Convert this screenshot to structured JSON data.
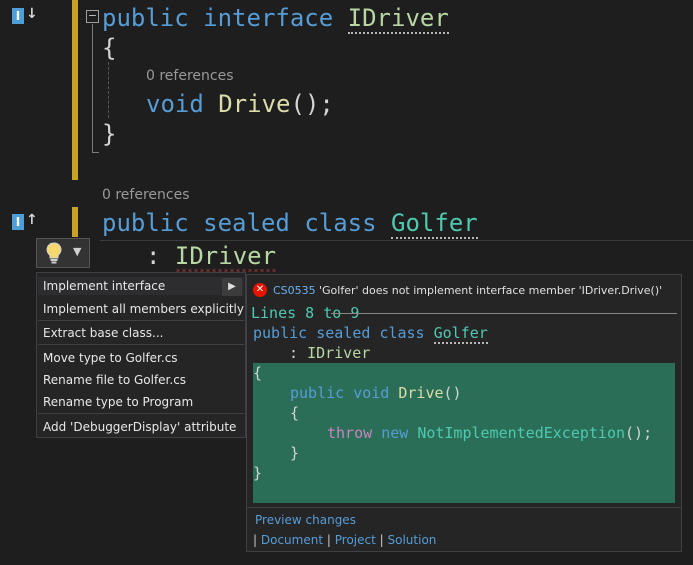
{
  "editor": {
    "line1": {
      "kw1": "public",
      "kw2": "interface",
      "name": "IDriver"
    },
    "open_brace": "{",
    "lens1": "0 references",
    "method": {
      "kw": "void",
      "name": "Drive",
      "rest": "();"
    },
    "close_brace": "}",
    "lens2": "0 references",
    "class_line": {
      "kw1": "public",
      "kw2": "sealed",
      "kw3": "class",
      "name": "Golfer"
    },
    "base_line": {
      "colon": ":",
      "name": "IDriver"
    },
    "glyph_up_letter": "I",
    "glyph_up_arrow": "↓",
    "glyph_down_letter": "I",
    "glyph_down_arrow": "↑",
    "collapse_symbol": "−"
  },
  "lightbulb": {
    "arrow": "▼"
  },
  "menu": {
    "items": [
      "Implement interface",
      "Implement all members explicitly",
      "Extract base class...",
      "Move type to Golfer.cs",
      "Rename file to Golfer.cs",
      "Rename type to Program",
      "Add 'DebuggerDisplay' attribute"
    ],
    "submenu_arrow": "▶"
  },
  "preview": {
    "error_icon": "✕",
    "error_code": "CS0535",
    "error_message": "'Golfer' does not implement interface member 'IDriver.Drive()'",
    "lines_header": "Lines 8 to 9",
    "class_line": {
      "kw1": "public",
      "kw2": "sealed",
      "kw3": "class",
      "name": "Golfer"
    },
    "base_line": {
      "colon": ":",
      "name": "IDriver"
    },
    "body": {
      "open": "{",
      "method": {
        "kw1": "public",
        "kw2": "void",
        "name": "Drive",
        "rest": "()"
      },
      "inner_open": "{",
      "throw_line": {
        "kw1": "throw",
        "kw2": "new",
        "type": "NotImplementedException",
        "rest": "();"
      },
      "inner_close": "}",
      "close": "}"
    },
    "preview_changes": "Preview changes",
    "scope": {
      "sep": "|",
      "document": "Document",
      "project": "Project",
      "solution": "Solution"
    }
  },
  "colors": {
    "accent_bar": "#c9a227",
    "preview_green": "#2b6e57",
    "keyword": "#569cd6",
    "type": "#4ec9b0",
    "interface": "#b8d7a3",
    "method": "#dcdcaa"
  }
}
